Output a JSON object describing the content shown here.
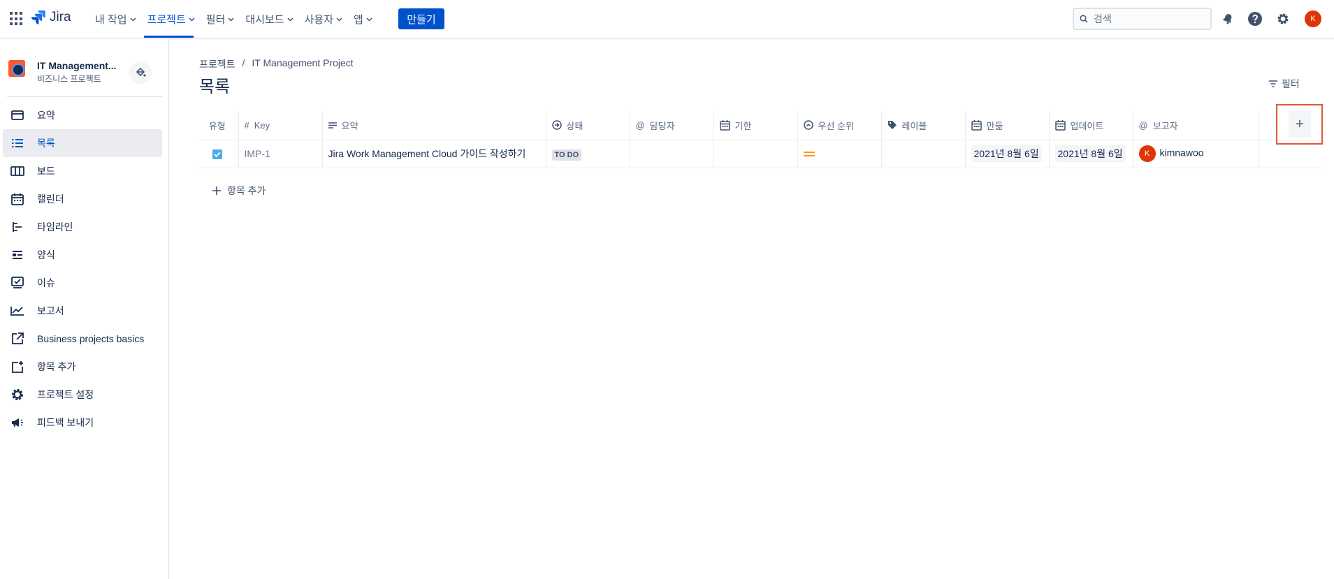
{
  "topnav": {
    "app_name": "Jira",
    "items": [
      {
        "label": "내 작업"
      },
      {
        "label": "프로젝트"
      },
      {
        "label": "필터"
      },
      {
        "label": "대시보드"
      },
      {
        "label": "사용자"
      },
      {
        "label": "앱"
      }
    ],
    "active_item": "프로젝트",
    "create_label": "만들기",
    "search_placeholder": "검색",
    "user_initial": "K"
  },
  "sidebar": {
    "project_name": "IT Management...",
    "project_type": "비즈니스 프로젝트",
    "items": [
      {
        "label": "요약",
        "icon": "summary-icon"
      },
      {
        "label": "목록",
        "icon": "list-icon"
      },
      {
        "label": "보드",
        "icon": "board-icon"
      },
      {
        "label": "캘린더",
        "icon": "calendar-icon"
      },
      {
        "label": "타임라인",
        "icon": "timeline-icon"
      },
      {
        "label": "양식",
        "icon": "form-icon"
      },
      {
        "label": "이슈",
        "icon": "issues-icon"
      },
      {
        "label": "보고서",
        "icon": "reports-icon"
      },
      {
        "label": "Business projects basics",
        "icon": "external-link-icon"
      },
      {
        "label": "항목 추가",
        "icon": "add-item-icon"
      },
      {
        "label": "프로젝트 설정",
        "icon": "gear-icon"
      },
      {
        "label": "피드백 보내기",
        "icon": "megaphone-icon"
      }
    ],
    "active_item": "목록"
  },
  "main": {
    "breadcrumb": [
      "프로젝트",
      "IT Management Project"
    ],
    "breadcrumb_sep": "/",
    "title": "목록",
    "filter_label": "필터",
    "columns": {
      "type": "유형",
      "key": "Key",
      "summary": "요약",
      "status": "상태",
      "assignee": "담당자",
      "due": "기한",
      "priority": "우선 순위",
      "labels": "레이블",
      "created": "만듦",
      "updated": "업데이트",
      "reporter": "보고자",
      "add_column": "+"
    },
    "rows": [
      {
        "key": "IMP-1",
        "summary": "Jira Work Management Cloud 가이드 작성하기",
        "status": "TO DO",
        "assignee": "",
        "due": "",
        "priority": "medium",
        "labels": "",
        "created": "2021년 8월 6일",
        "updated": "2021년 8월 6일",
        "reporter": "kimnawoo",
        "reporter_initial": "K"
      }
    ],
    "add_item_label": "항목 추가"
  }
}
